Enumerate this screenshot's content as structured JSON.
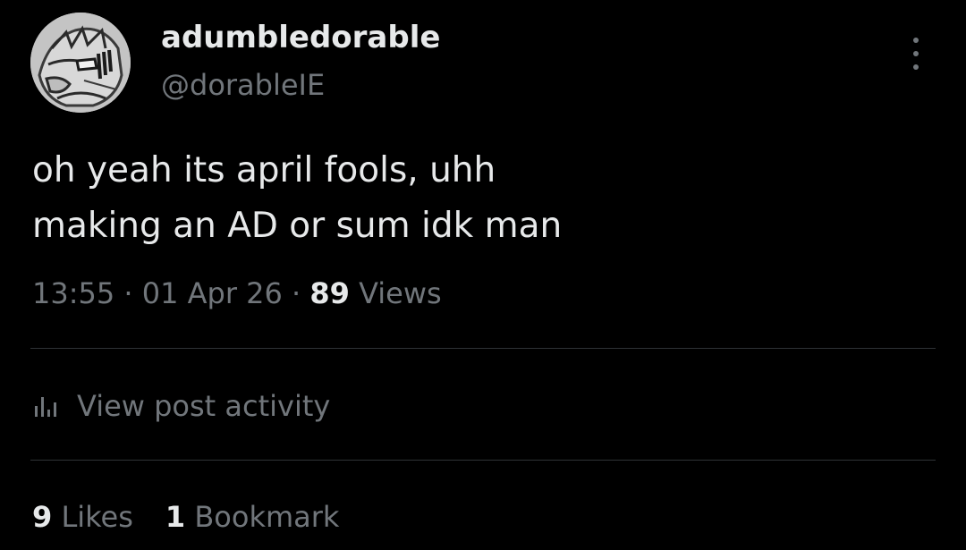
{
  "author": {
    "display_name": "adumbledorable",
    "handle": "@dorableIE",
    "avatar_icon": "sketch-avatar"
  },
  "post": {
    "lines": [
      "oh yeah its april fools, uhh",
      "making an AD or sum idk man"
    ]
  },
  "meta": {
    "time": "13:55",
    "separator": "·",
    "date": "01 Apr 26",
    "views_count": "89",
    "views_label": "Views"
  },
  "activity": {
    "icon": "bar-chart-icon",
    "label": "View post activity"
  },
  "stats": {
    "likes_count": "9",
    "likes_label": "Likes",
    "bookmarks_count": "1",
    "bookmarks_label": "Bookmark"
  },
  "menu": {
    "icon": "more-vertical-icon"
  },
  "colors": {
    "background": "#000000",
    "primary_text": "#e7e9ea",
    "secondary_text": "#71767b",
    "divider": "#2f3336"
  }
}
